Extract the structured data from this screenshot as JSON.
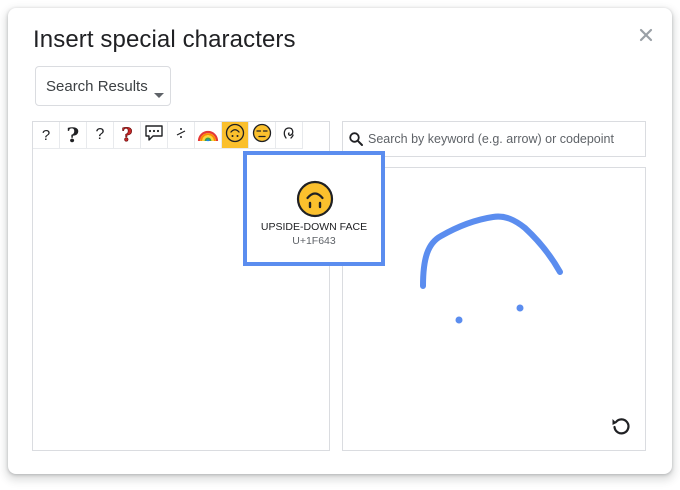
{
  "dialog": {
    "title": "Insert special characters",
    "close_icon": "close-icon"
  },
  "category": {
    "selected": "Search Results"
  },
  "search": {
    "placeholder": "Search by keyword (e.g. arrow) or codepoint",
    "value": ""
  },
  "results": [
    {
      "glyph": "?",
      "icon": "question-mark"
    },
    {
      "glyph": "?",
      "icon": "ornate-question-mark-icon"
    },
    {
      "glyph": "?",
      "icon": "small-question-mark"
    },
    {
      "glyph": "?",
      "icon": "red-question-mark-icon"
    },
    {
      "glyph": "",
      "icon": "speech-balloon-icon"
    },
    {
      "glyph": "⁂",
      "icon": "dotted-symbol-icon"
    },
    {
      "glyph": "",
      "icon": "rainbow-icon"
    },
    {
      "glyph": "",
      "icon": "upside-down-face-icon"
    },
    {
      "glyph": "",
      "icon": "unamused-face-icon"
    },
    {
      "glyph": "",
      "icon": "spiral-symbol-icon"
    }
  ],
  "tooltip": {
    "name": "UPSIDE-DOWN FACE",
    "codepoint": "U+1F643"
  },
  "colors": {
    "accent_blue": "#5b8def",
    "selected_cell": "#fbc02d",
    "emoji_yellow": "#fbc02d"
  }
}
